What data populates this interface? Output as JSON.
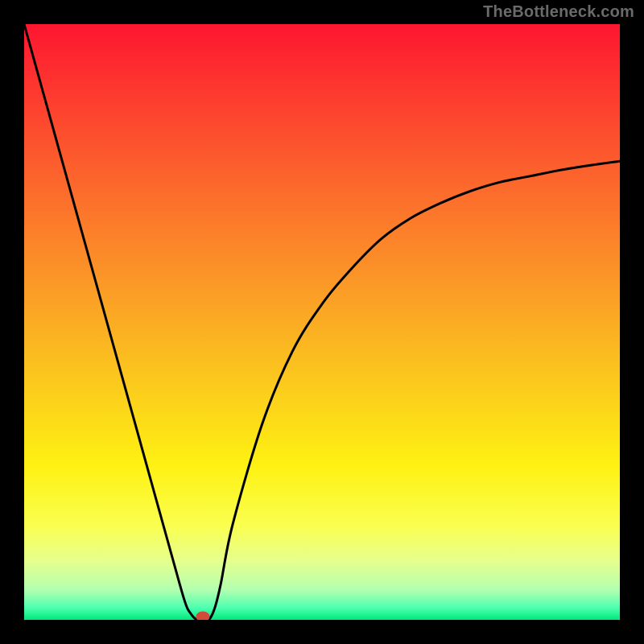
{
  "watermark": "TheBottleneck.com",
  "chart_data": {
    "type": "line",
    "title": "",
    "xlabel": "",
    "ylabel": "",
    "xlim": [
      0,
      100
    ],
    "ylim": [
      0,
      100
    ],
    "grid": false,
    "legend": false,
    "series": [
      {
        "name": "bottleneck-curve",
        "x": [
          0,
          5,
          10,
          15,
          20,
          25,
          27,
          28,
          29,
          30,
          31,
          32,
          33,
          35,
          40,
          45,
          50,
          55,
          60,
          65,
          70,
          75,
          80,
          85,
          90,
          95,
          100
        ],
        "values": [
          100,
          82,
          64,
          46,
          28,
          10,
          3,
          1,
          0,
          0,
          0,
          2,
          6,
          16,
          33,
          45,
          53,
          59,
          64,
          67.5,
          70,
          72,
          73.5,
          74.5,
          75.5,
          76.3,
          77
        ]
      }
    ],
    "marker": {
      "x": 30,
      "y": 0
    },
    "background_gradient": {
      "direction": "vertical",
      "stops": [
        {
          "pos": 0.0,
          "color": "#fd1630"
        },
        {
          "pos": 0.12,
          "color": "#fd3b2f"
        },
        {
          "pos": 0.28,
          "color": "#fc6b2c"
        },
        {
          "pos": 0.44,
          "color": "#fb9a27"
        },
        {
          "pos": 0.6,
          "color": "#fbc91d"
        },
        {
          "pos": 0.74,
          "color": "#fef112"
        },
        {
          "pos": 0.84,
          "color": "#faff4e"
        },
        {
          "pos": 0.9,
          "color": "#e7ff8c"
        },
        {
          "pos": 0.95,
          "color": "#b2ffb0"
        },
        {
          "pos": 0.98,
          "color": "#4dffb0"
        },
        {
          "pos": 1.0,
          "color": "#00e97a"
        }
      ]
    }
  }
}
